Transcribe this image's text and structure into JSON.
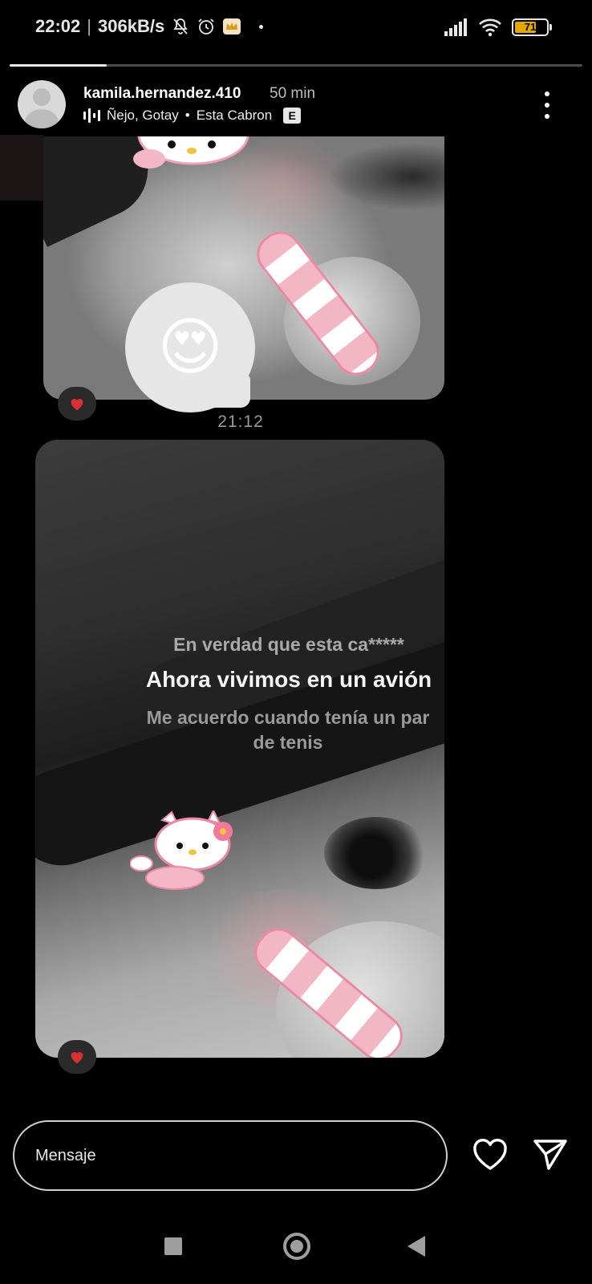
{
  "status_bar": {
    "time": "22:02",
    "speed": "306kB/s",
    "battery": "71",
    "battery_level": 0.71,
    "icons": [
      "notifications-off-icon",
      "alarm-icon",
      "crown-app-icon",
      "dot-icon",
      "signal-icon",
      "wifi-icon",
      "battery-icon"
    ]
  },
  "story": {
    "progress": 0.17,
    "username": "kamila.hernandez.410",
    "time_ago": "50 min",
    "music": {
      "track": "Ñejo, Gotay",
      "separator": "•",
      "song": "Esta Cabron",
      "explicit": "E"
    }
  },
  "messages": {
    "reaction_emoji": "😍",
    "time": "21:12"
  },
  "lyrics": {
    "previous": "En verdad que esta ca*****",
    "current": "Ahora vivimos en un avión",
    "next": "Me acuerdo cuando tenía un par de tenis"
  },
  "composer": {
    "placeholder": "Mensaje"
  },
  "colors": {
    "background": "#000000",
    "heart_reaction": "#d8312f",
    "battery_fill": "#e0a800"
  }
}
